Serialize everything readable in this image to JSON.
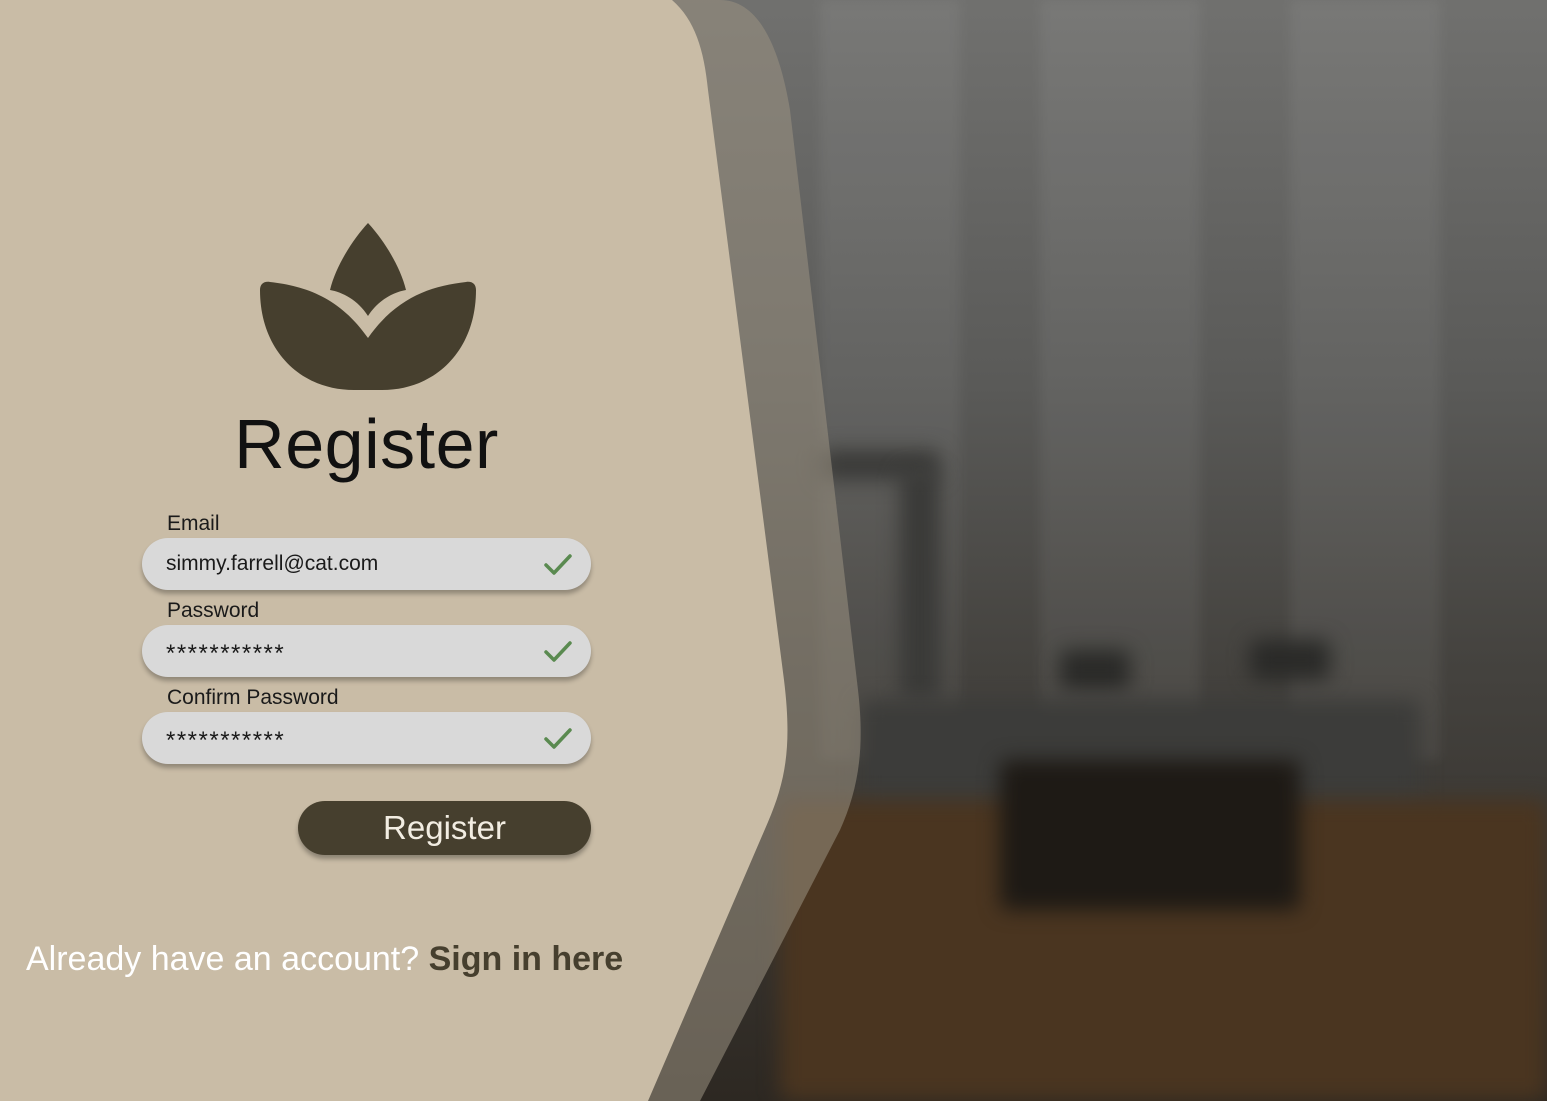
{
  "app": {
    "title": "Register"
  },
  "form": {
    "email": {
      "label": "Email",
      "value": "simmy.farrell@cat.com",
      "valid": true
    },
    "password": {
      "label": "Password",
      "value": "***********",
      "valid": true
    },
    "confirm_password": {
      "label": "Confirm Password",
      "value": "***********",
      "valid": true
    },
    "submit_label": "Register"
  },
  "footer": {
    "prompt": "Already have an account? ",
    "link_label": "Sign in here"
  },
  "icons": {
    "logo": "lotus-icon",
    "valid": "check-icon"
  },
  "colors": {
    "panel": "#c9bca6",
    "accent": "#463f2e",
    "field": "#d9d9d9",
    "check": "#5a8a50"
  }
}
